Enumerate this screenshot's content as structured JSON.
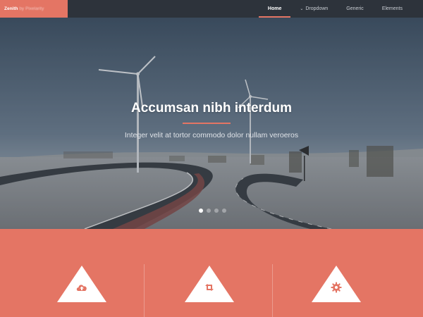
{
  "brand": {
    "name": "Zenith",
    "byline": "by Pixelarity"
  },
  "nav": {
    "items": [
      {
        "label": "Home",
        "active": true,
        "has_dropdown": false
      },
      {
        "label": "Dropdown",
        "active": false,
        "has_dropdown": true
      },
      {
        "label": "Generic",
        "active": false,
        "has_dropdown": false
      },
      {
        "label": "Elements",
        "active": false,
        "has_dropdown": false
      }
    ]
  },
  "hero": {
    "title": "Accumsan nibh interdum",
    "subtitle": "Integer velit at tortor commodo dolor nullam veroeros",
    "slides": 4,
    "active_slide": 1
  },
  "features": [
    {
      "icon": "cloud-upload-icon"
    },
    {
      "icon": "retweet-icon"
    },
    {
      "icon": "gear-icon"
    }
  ],
  "colors": {
    "accent": "#e47564",
    "navbar": "#2d333b"
  }
}
